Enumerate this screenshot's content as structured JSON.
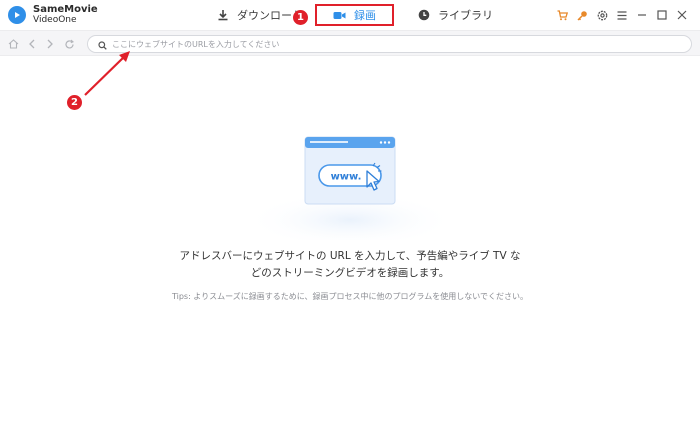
{
  "app": {
    "name_line1": "SameMovie",
    "name_line2": "VideoOne"
  },
  "tabs": [
    {
      "label": "ダウンロード",
      "icon": "download-icon"
    },
    {
      "label": "録画",
      "icon": "video-camera-icon"
    },
    {
      "label": "ライブラリ",
      "icon": "clock-icon"
    }
  ],
  "markers": {
    "m1": "1",
    "m2": "2"
  },
  "window_controls": [
    "cart-icon",
    "key-icon",
    "settings-icon",
    "menu-icon",
    "minimize-icon",
    "maximize-icon",
    "close-icon"
  ],
  "browser": {
    "url_placeholder": "ここにウェブサイトのURLを入力してください",
    "url_value": ""
  },
  "main": {
    "illustration_text": "www.",
    "message_line1": "アドレスバーにウェブサイトの URL を入力して、予告編やライブ TV な",
    "message_line2": "どのストリーミングビデオを録画します。",
    "tips": "Tips: よりスムーズに録画するために、録画プロセス中に他のプログラムを使用しないでください。"
  },
  "colors": {
    "accent": "#2f8fe8",
    "highlight": "#e0202a",
    "shortcut_icons": "#e8892a"
  }
}
